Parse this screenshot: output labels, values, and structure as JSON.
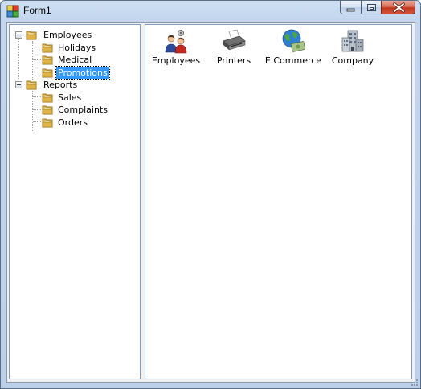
{
  "window": {
    "title": "Form1"
  },
  "tree": {
    "employees": {
      "label": "Employees"
    },
    "holidays": {
      "label": "Holidays"
    },
    "medical": {
      "label": "Medical"
    },
    "promotions": {
      "label": "Promotions",
      "selected": true
    },
    "reports": {
      "label": "Reports"
    },
    "sales": {
      "label": "Sales"
    },
    "complaints": {
      "label": "Complaints"
    },
    "orders": {
      "label": "Orders"
    }
  },
  "listview": {
    "items": [
      {
        "label": "Employees",
        "icon": "users-icon"
      },
      {
        "label": "Printers",
        "icon": "printer-icon"
      },
      {
        "label": "E Commerce",
        "icon": "globe-money-icon"
      },
      {
        "label": "Company",
        "icon": "building-icon"
      }
    ]
  },
  "colors": {
    "selection": "#3399ff",
    "close_button": "#c0391f",
    "titlebar": "#c3d6ee"
  }
}
